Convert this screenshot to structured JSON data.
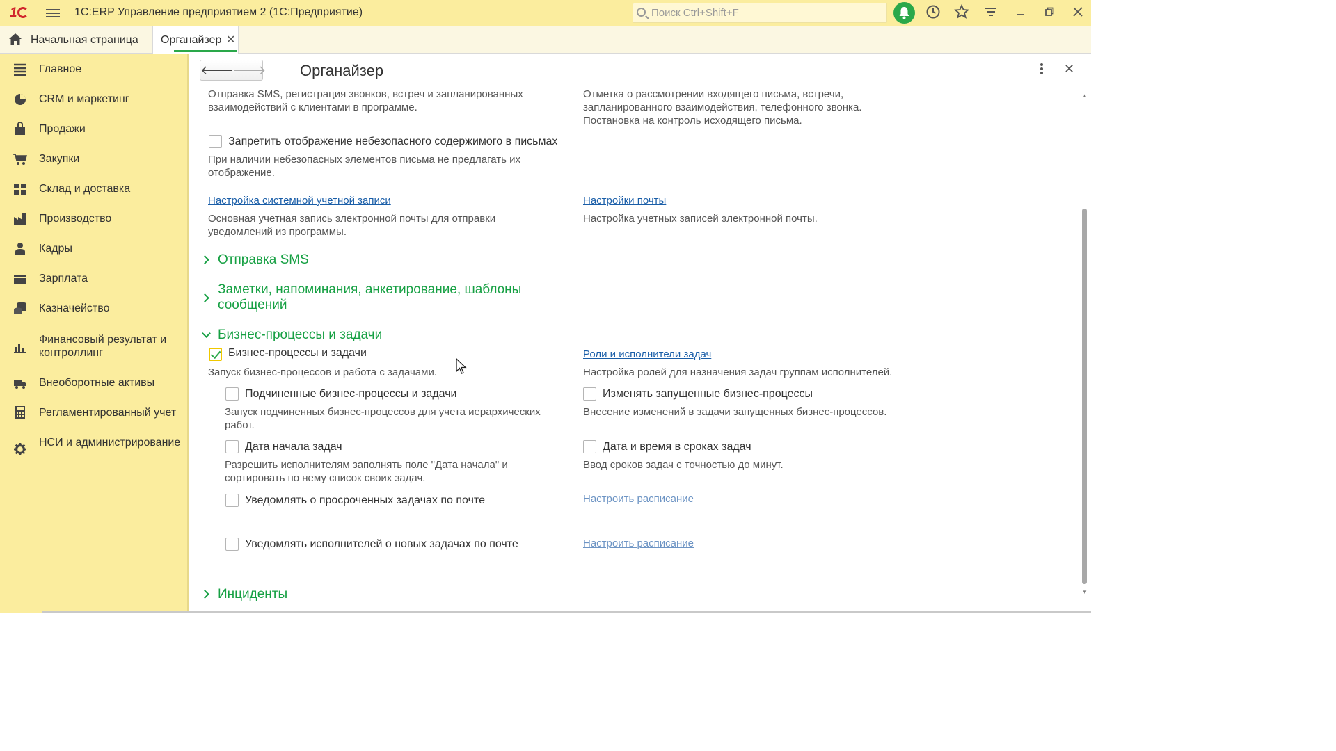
{
  "app": {
    "title": "1С:ERP Управление предприятием 2  (1С:Предприятие)",
    "search_placeholder": "Поиск Ctrl+Shift+F"
  },
  "tabs": {
    "home_label": "Начальная страница",
    "active_label": "Органайзер",
    "close_glyph": "✕"
  },
  "sidebar": {
    "items": [
      {
        "label": "Главное",
        "icon": "menu-list-icon"
      },
      {
        "label": "CRM и маркетинг",
        "icon": "pie-chart-icon"
      },
      {
        "label": "Продажи",
        "icon": "shopping-bag-icon"
      },
      {
        "label": "Закупки",
        "icon": "cart-icon"
      },
      {
        "label": "Склад и доставка",
        "icon": "warehouse-icon"
      },
      {
        "label": "Производство",
        "icon": "factory-icon"
      },
      {
        "label": "Кадры",
        "icon": "person-icon"
      },
      {
        "label": "Зарплата",
        "icon": "wallet-icon"
      },
      {
        "label": "Казначейство",
        "icon": "coins-icon"
      },
      {
        "label": "Финансовый результат и контроллинг",
        "icon": "bar-chart-icon"
      },
      {
        "label": "Внеоборотные активы",
        "icon": "truck-icon"
      },
      {
        "label": "Регламентированный учет",
        "icon": "calculator-icon"
      },
      {
        "label": "НСИ и администрирование",
        "icon": "gear-icon"
      }
    ]
  },
  "page": {
    "title": "Органайзер",
    "back_glyph": "🡐",
    "forward_glyph": "🡒"
  },
  "content": {
    "desc_sms_left": "Отправка SMS, регистрация звонков, встреч и запланированных взаимодействий с клиентами в программе.",
    "desc_right_top": "Отметка о рассмотрении входящего письма, встречи, запланированного взаимодействия, телефонного звонка. Постановка на контроль исходящего письма.",
    "unsafe_content": {
      "label": "Запретить отображение небезопасного содержимого в письмах",
      "checked": false
    },
    "unsafe_desc": "При наличии небезопасных элементов письма не предлагать их отображение.",
    "link_system_account": "Настройка системной учетной записи",
    "system_account_desc": "Основная учетная запись электронной почты для отправки уведомлений из программы.",
    "link_mail_settings": "Настройки почты",
    "mail_settings_desc": "Настройка учетных записей электронной почты.",
    "section_sms": "Отправка SMS",
    "section_notes": "Заметки, напоминания, анкетирование, шаблоны сообщений",
    "section_bp": "Бизнес-процессы и задачи",
    "bp_main": {
      "label": "Бизнес-процессы и задачи",
      "checked": true
    },
    "bp_main_desc": "Запуск бизнес-процессов и работа с задачами.",
    "link_roles": "Роли и исполнители задач",
    "roles_desc": "Настройка ролей для назначения задач группам исполнителей.",
    "sub_bp": {
      "label": "Подчиненные бизнес-процессы и задачи",
      "checked": false
    },
    "sub_bp_desc": "Запуск подчиненных бизнес-процессов для учета иерархических работ.",
    "change_running": {
      "label": "Изменять запущенные бизнес-процессы",
      "checked": false
    },
    "change_running_desc": "Внесение изменений в задачи запущенных бизнес-процессов.",
    "start_date": {
      "label": "Дата начала задач",
      "checked": false
    },
    "start_date_desc": "Разрешить исполнителям заполнять поле \"Дата начала\" и сортировать по нему список своих задач.",
    "date_time": {
      "label": "Дата и время в сроках задач",
      "checked": false
    },
    "date_time_desc": "Ввод сроков задач с точностью до минут.",
    "notify_overdue": {
      "label": "Уведомлять о просроченных задачах по почте",
      "checked": false
    },
    "link_schedule_1": "Настроить расписание",
    "notify_new": {
      "label": "Уведомлять исполнителей о новых задачах по почте",
      "checked": false
    },
    "link_schedule_2": "Настроить расписание",
    "section_incidents": "Инциденты"
  },
  "colors": {
    "accent_green": "#16a043",
    "sidebar_bg": "#fbed9e",
    "link_blue": "#1a5ea8"
  }
}
